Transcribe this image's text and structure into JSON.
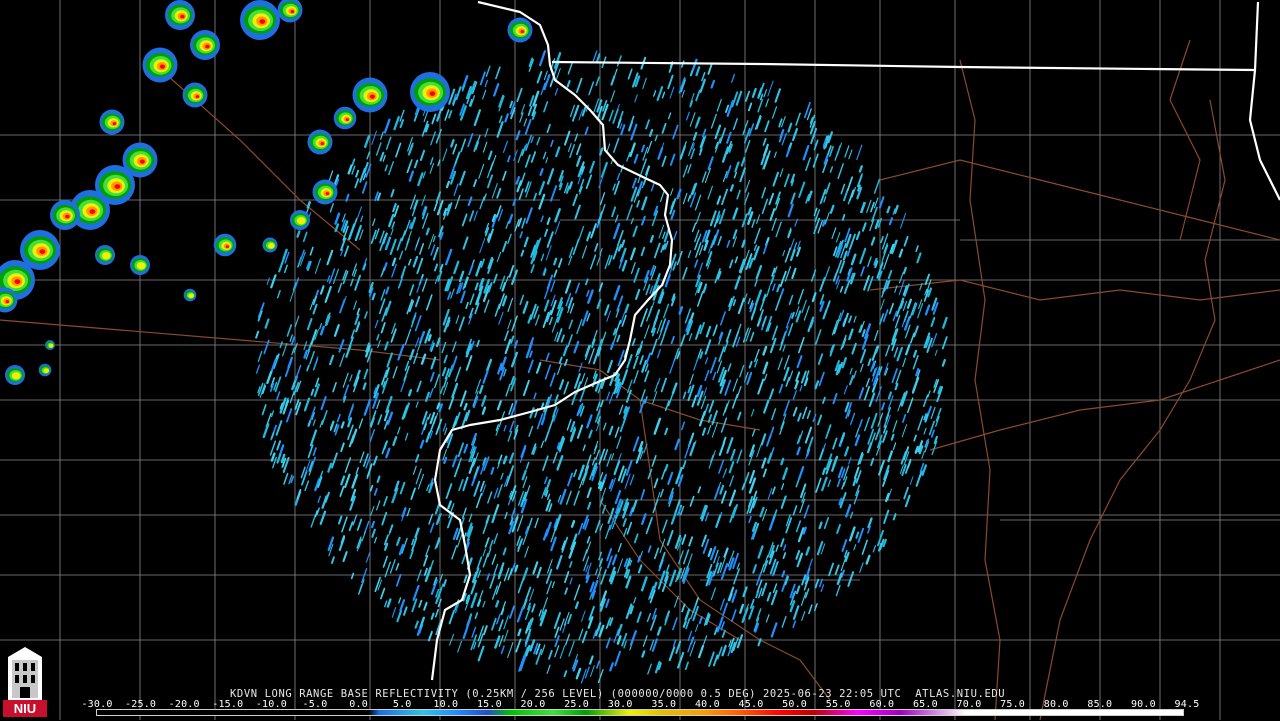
{
  "radar": {
    "caption": "KDVN LONG RANGE BASE REFLECTIVITY (0.25KM / 256 LEVEL) (000000/0000 0.5 DEG) 2025-06-23 22:05 UTC  ATLAS.NIU.EDU",
    "scale_values": [
      "-30.0",
      "-25.0",
      "-20.0",
      "-15.0",
      "-10.0",
      "-5.0",
      "0.0",
      "5.0",
      "10.0",
      "15.0",
      "20.0",
      "25.0",
      "30.0",
      "35.0",
      "40.0",
      "45.0",
      "50.0",
      "55.0",
      "60.0",
      "65.0",
      "70.0",
      "75.0",
      "80.0",
      "85.0",
      "90.0",
      "94.5"
    ],
    "colors": {
      "background": "#000000",
      "state_border": "#ffffff",
      "county_border": "#8a8a8a",
      "highway": "#8b4a2b",
      "clear_air": "#2ec4e6",
      "light_blue": "#1e90ff",
      "green": "#2ad12a",
      "yellow": "#ffe000",
      "orange": "#ff8c00",
      "red": "#e6001a"
    }
  },
  "logo": {
    "text": "NIU",
    "icon": "niu-tower-logo-icon"
  }
}
